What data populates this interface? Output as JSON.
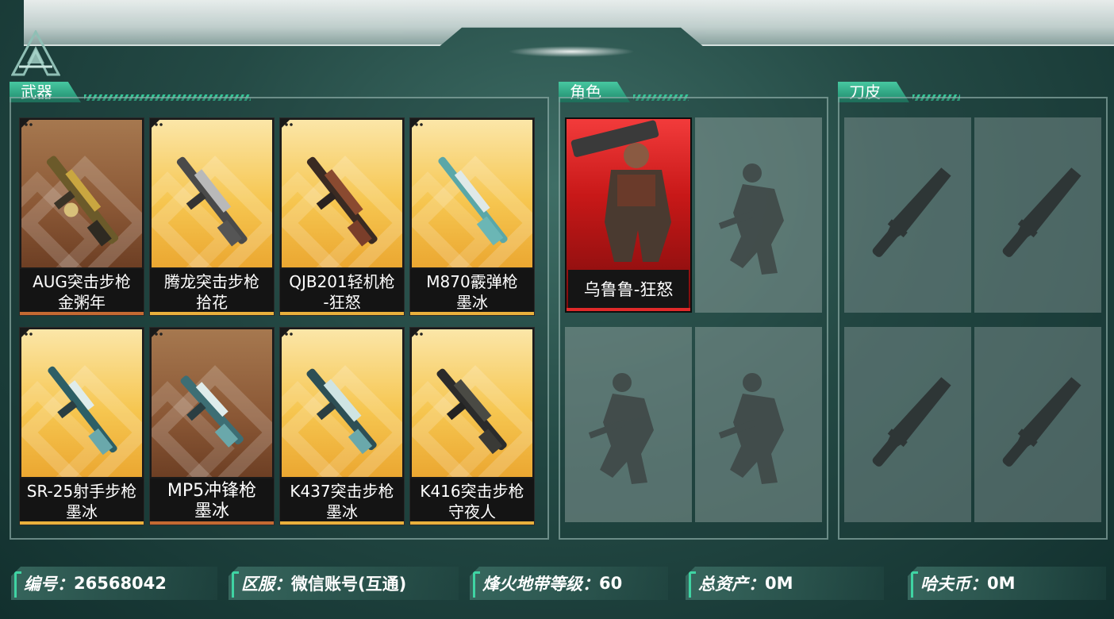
{
  "sections": {
    "weapons": "武器",
    "characters": "角色",
    "knives": "刀皮"
  },
  "weapons": [
    {
      "line1": "AUG突击步枪",
      "line2": "金粥年",
      "rarity": "brown"
    },
    {
      "line1": "腾龙突击步枪",
      "line2": "拾花",
      "rarity": "gold"
    },
    {
      "line1": "QJB201轻机枪",
      "line2": "-狂怒",
      "rarity": "gold"
    },
    {
      "line1": "M870霰弹枪",
      "line2": "墨冰",
      "rarity": "gold"
    },
    {
      "line1": "SR-25射手步枪",
      "line2": "墨冰",
      "rarity": "gold"
    },
    {
      "line1": "MP5冲锋枪",
      "line2": "墨冰",
      "rarity": "brown"
    },
    {
      "line1": "K437突击步枪",
      "line2": "墨冰",
      "rarity": "gold"
    },
    {
      "line1": "K416突击步枪",
      "line2": "守夜人",
      "rarity": "gold"
    }
  ],
  "characters": [
    {
      "name": "乌鲁鲁-狂怒",
      "filled": true
    },
    {
      "name": "",
      "filled": false
    },
    {
      "name": "",
      "filled": false
    },
    {
      "name": "",
      "filled": false
    }
  ],
  "info": {
    "id_label": "编号：",
    "id_value": "26568042",
    "server_label": "区服：",
    "server_value": "微信账号(互通)",
    "level_label": "烽火地带等级：",
    "level_value": "60",
    "assets_label": "总资产：",
    "assets_value": "0M",
    "coin_label": "哈夫币：",
    "coin_value": "0M"
  },
  "colors": {
    "accent": "#33c596",
    "gold_card": "#f6c650",
    "brown_card": "#8a5735",
    "red_card": "#c81818"
  }
}
